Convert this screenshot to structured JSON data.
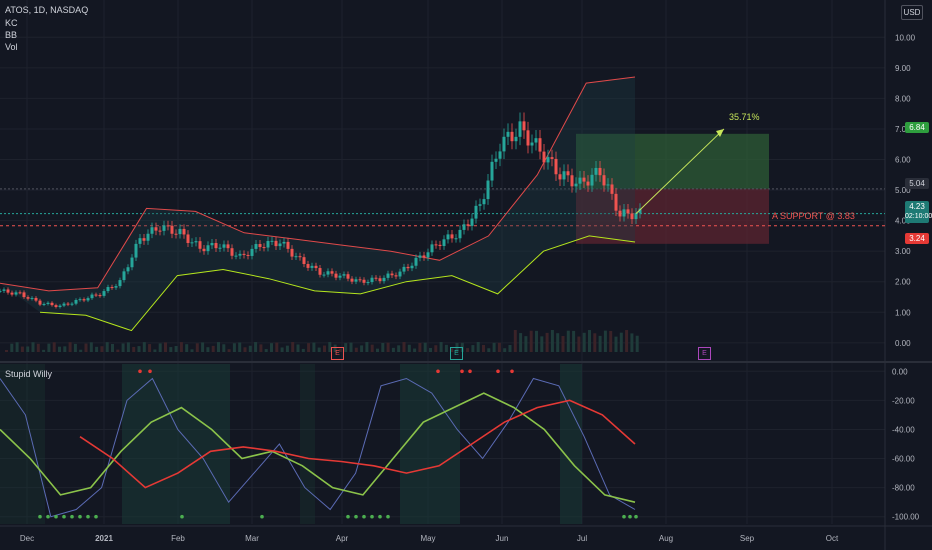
{
  "header": {
    "symbol_line": "ATOS, 1D, NASDAQ",
    "indicators": [
      "KC",
      "BB",
      "Vol"
    ],
    "currency": "USD",
    "oscillator_name": "Stupid Willy"
  },
  "price_tags": {
    "target": "6.84",
    "previous": "5.04",
    "last": "4.23",
    "countdown": "02:10:00",
    "stop": "3.24"
  },
  "annotations": {
    "gain": "35.71%",
    "support": "A SUPPORT @ 3.83",
    "earnings": [
      "E",
      "E",
      "E"
    ]
  },
  "colors": {
    "background": "#131722",
    "up": "#26a69a",
    "down": "#ef5350",
    "profit_zone": "#2e5c35",
    "loss_zone": "#5c2430",
    "target_arrow": "#c7e65a",
    "support_line": "#ef5350"
  },
  "chart_data": [
    {
      "type": "candlestick",
      "title": "ATOS, 1D, NASDAQ",
      "x_ticks": [
        "Dec",
        "2021",
        "Feb",
        "Mar",
        "Apr",
        "May",
        "Jun",
        "Jul",
        "Aug",
        "Sep",
        "Oct"
      ],
      "y_ticks": [
        "10.00",
        "9.00",
        "8.00",
        "7.00",
        "6.00",
        "5.00",
        "4.00",
        "3.00",
        "2.00",
        "1.00",
        "0.00"
      ],
      "ylim": [
        -0.3,
        10.5
      ],
      "approx_close": [
        1.7,
        1.6,
        1.3,
        1.2,
        1.4,
        1.6,
        2.0,
        3.4,
        3.8,
        3.6,
        3.1,
        3.2,
        2.8,
        3.2,
        3.3,
        2.7,
        2.3,
        2.2,
        2.0,
        2.1,
        2.3,
        2.8,
        3.3,
        3.6,
        4.5,
        6.5,
        7.0,
        6.3,
        5.5,
        5.2,
        5.6,
        4.2,
        4.23
      ],
      "bollinger_upper_approx": [
        1.95,
        1.7,
        1.8,
        4.4,
        4.3,
        3.6,
        3.4,
        3.2,
        3.0,
        2.7,
        3.5,
        5.5,
        8.5,
        8.7
      ],
      "keltner_lower_approx": [
        1.0,
        0.9,
        0.4,
        2.2,
        2.4,
        2.1,
        1.7,
        1.6,
        2.0,
        2.2,
        1.6,
        3.0,
        3.5,
        3.3
      ],
      "support_level": 3.83,
      "position": {
        "entry": 5.04,
        "target": 6.84,
        "stop": 3.24,
        "gain_pct": "35.71%"
      },
      "grid": true
    },
    {
      "type": "line",
      "title": "Stupid Willy",
      "y_ticks": [
        "0.00",
        "-20.00",
        "-40.00",
        "-60.00",
        "-80.00",
        "-100.00"
      ],
      "ylim": [
        -105,
        5
      ],
      "series": [
        {
          "color": "#5b6bb5",
          "values": [
            -5,
            -30,
            -100,
            -95,
            -80,
            -20,
            -5,
            -40,
            -60,
            -90,
            -70,
            -50,
            -80,
            -95,
            -70,
            -10,
            -5,
            -15,
            -40,
            -60,
            -35,
            -5,
            -10,
            -45,
            -85,
            -95
          ]
        },
        {
          "color": "#8bc34a",
          "values": [
            -40,
            -60,
            -85,
            -80,
            -55,
            -35,
            -25,
            -40,
            -60,
            -55,
            -65,
            -80,
            -85,
            -60,
            -35,
            -25,
            -15,
            -25,
            -40,
            -65,
            -85,
            -90
          ]
        },
        {
          "color": "#e53935",
          "values": [
            -45,
            -60,
            -80,
            -70,
            -55,
            -52,
            -55,
            -60,
            -62,
            -65,
            -70,
            -65,
            -50,
            -35,
            -25,
            -20,
            -30,
            -50
          ]
        }
      ],
      "grid": true
    }
  ]
}
